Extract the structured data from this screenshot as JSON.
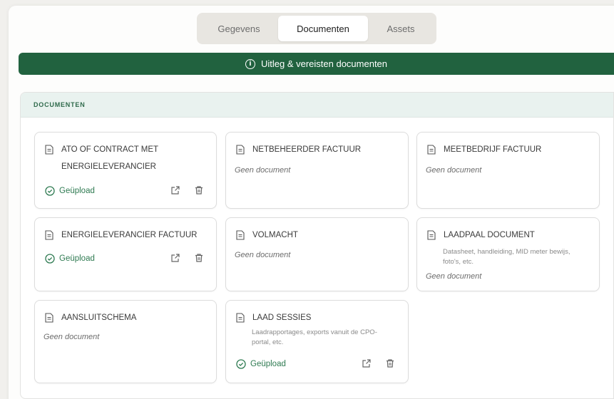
{
  "tabs": [
    {
      "label": "Gegevens",
      "active": false
    },
    {
      "label": "Documenten",
      "active": true
    },
    {
      "label": "Assets",
      "active": false
    }
  ],
  "banner": {
    "text": "Uitleg & vereisten documenten",
    "icon": "info-icon",
    "color": "#21623f"
  },
  "section": {
    "header": "DOCUMENTEN"
  },
  "colors": {
    "accent_green": "#21623f",
    "uploaded_green": "#2e7a51",
    "header_bg": "#e9f2ef"
  },
  "cards": [
    {
      "title": "ATO OF CONTRACT MET",
      "title2": "ENERGIELEVERANCIER",
      "status": "Geüpload"
    },
    {
      "title": "NETBEHEERDER FACTUUR",
      "empty": "Geen document"
    },
    {
      "title": "MEETBEDRIJF FACTUUR",
      "empty": "Geen document"
    },
    {
      "title": "ENERGIELEVERANCIER FACTUUR",
      "status": "Geüpload"
    },
    {
      "title": "VOLMACHT",
      "empty": "Geen document"
    },
    {
      "title": "LAADPAAL DOCUMENT",
      "subtitle": "Datasheet, handleiding, MID meter bewijs,",
      "subtitle2": "foto's, etc.",
      "empty": "Geen document"
    },
    {
      "title": "AANSLUITSCHEMA",
      "empty": "Geen document"
    },
    {
      "title": "LAAD SESSIES",
      "subtitle": "Laadrapportages, exports vanuit de CPO-",
      "subtitle2": "portal, etc.",
      "status": "Geüpload"
    }
  ]
}
